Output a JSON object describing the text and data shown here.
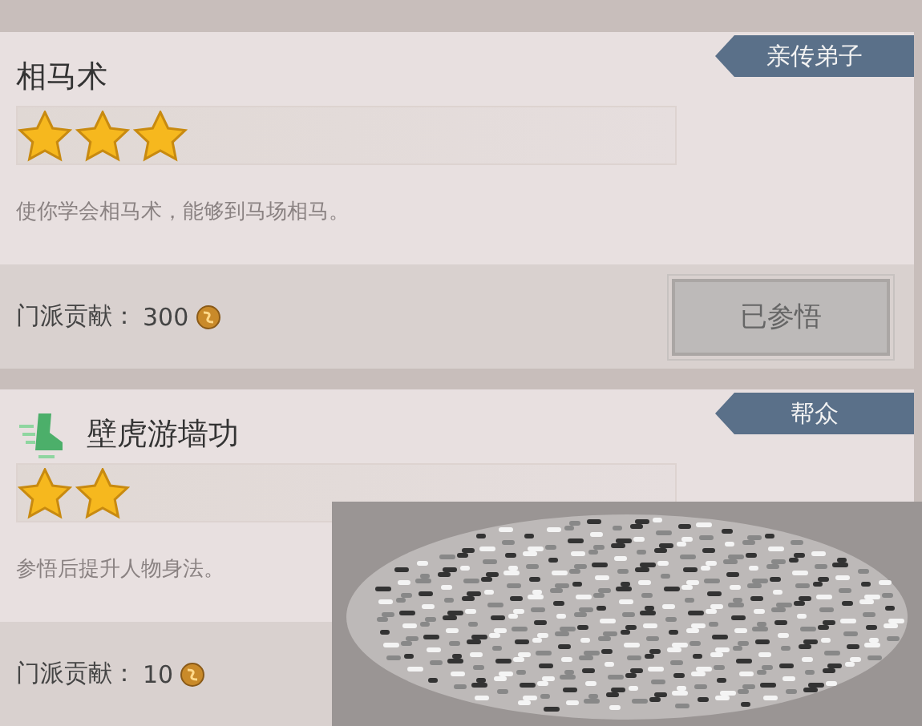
{
  "skills": [
    {
      "name": "相马术",
      "icon": false,
      "tag": "亲传弟子",
      "stars": 3,
      "description": "使你学会相马术，能够到马场相马。",
      "cost_label": "门派贡献：",
      "cost_value": "300",
      "button": {
        "label": "已参悟",
        "disabled": true
      }
    },
    {
      "name": "壁虎游墙功",
      "icon": true,
      "tag": "帮众",
      "stars": 2,
      "description": "参悟后提升人物身法。",
      "cost_label": "门派贡献：",
      "cost_value": "10"
    }
  ],
  "overlay": {
    "kind": "noise"
  }
}
